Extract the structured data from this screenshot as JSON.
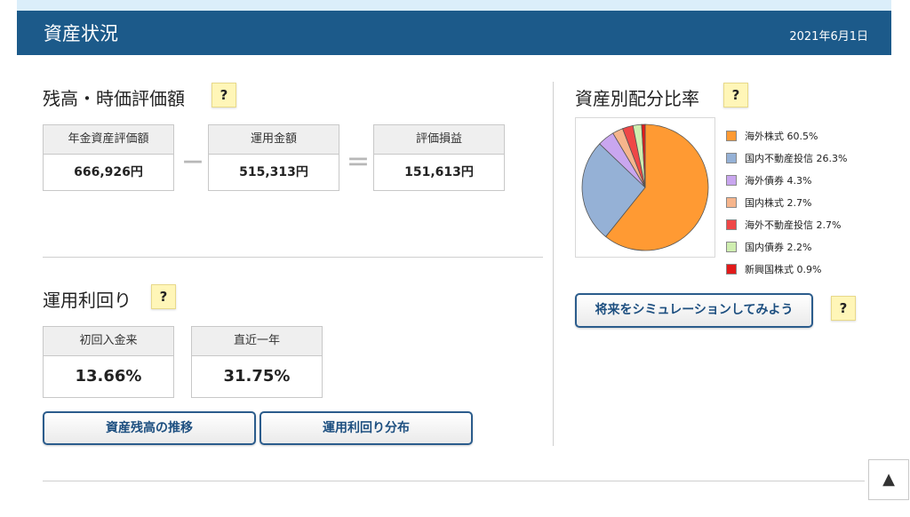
{
  "header": {
    "title": "資産状況",
    "date": "2021年6月1日"
  },
  "balance": {
    "title": "残高・時価評価額",
    "help": "?",
    "cards": [
      {
        "label": "年金資産評価額",
        "value": "666,926円"
      },
      {
        "label": "運用金額",
        "value": "515,313円"
      },
      {
        "label": "評価損益",
        "value": "151,613円"
      }
    ],
    "op_minus": "－",
    "op_equal": "＝"
  },
  "yield": {
    "title": "運用利回り",
    "help": "?",
    "cards": [
      {
        "label": "初回入金来",
        "value": "13.66%"
      },
      {
        "label": "直近一年",
        "value": "31.75%"
      }
    ],
    "buttons": {
      "history": "資産残高の推移",
      "distribution": "運用利回り分布"
    }
  },
  "allocation": {
    "title": "資産別配分比率",
    "help": "?",
    "simulate_button": "将来をシミュレーションしてみよう",
    "simulate_help": "?"
  },
  "chart_data": {
    "type": "pie",
    "categories": [
      "海外株式",
      "国内不動産投信",
      "海外債券",
      "国内株式",
      "海外不動産投信",
      "国内債券",
      "新興国株式"
    ],
    "values": [
      60.5,
      26.3,
      4.3,
      2.7,
      2.7,
      2.2,
      0.9
    ],
    "legend_labels": [
      "海外株式 60.5%",
      "国内不動産投信 26.3%",
      "海外債券 4.3%",
      "国内株式 2.7%",
      "海外不動産投信 2.7%",
      "国内債券 2.2%",
      "新興国株式 0.9%"
    ],
    "colors": [
      "#ff9a33",
      "#95b1d6",
      "#c9a6ef",
      "#f6b58c",
      "#ef4747",
      "#cfeeb0",
      "#e21a1a"
    ],
    "legend_position": "right"
  },
  "nav": {
    "back_to_top": "▲"
  }
}
